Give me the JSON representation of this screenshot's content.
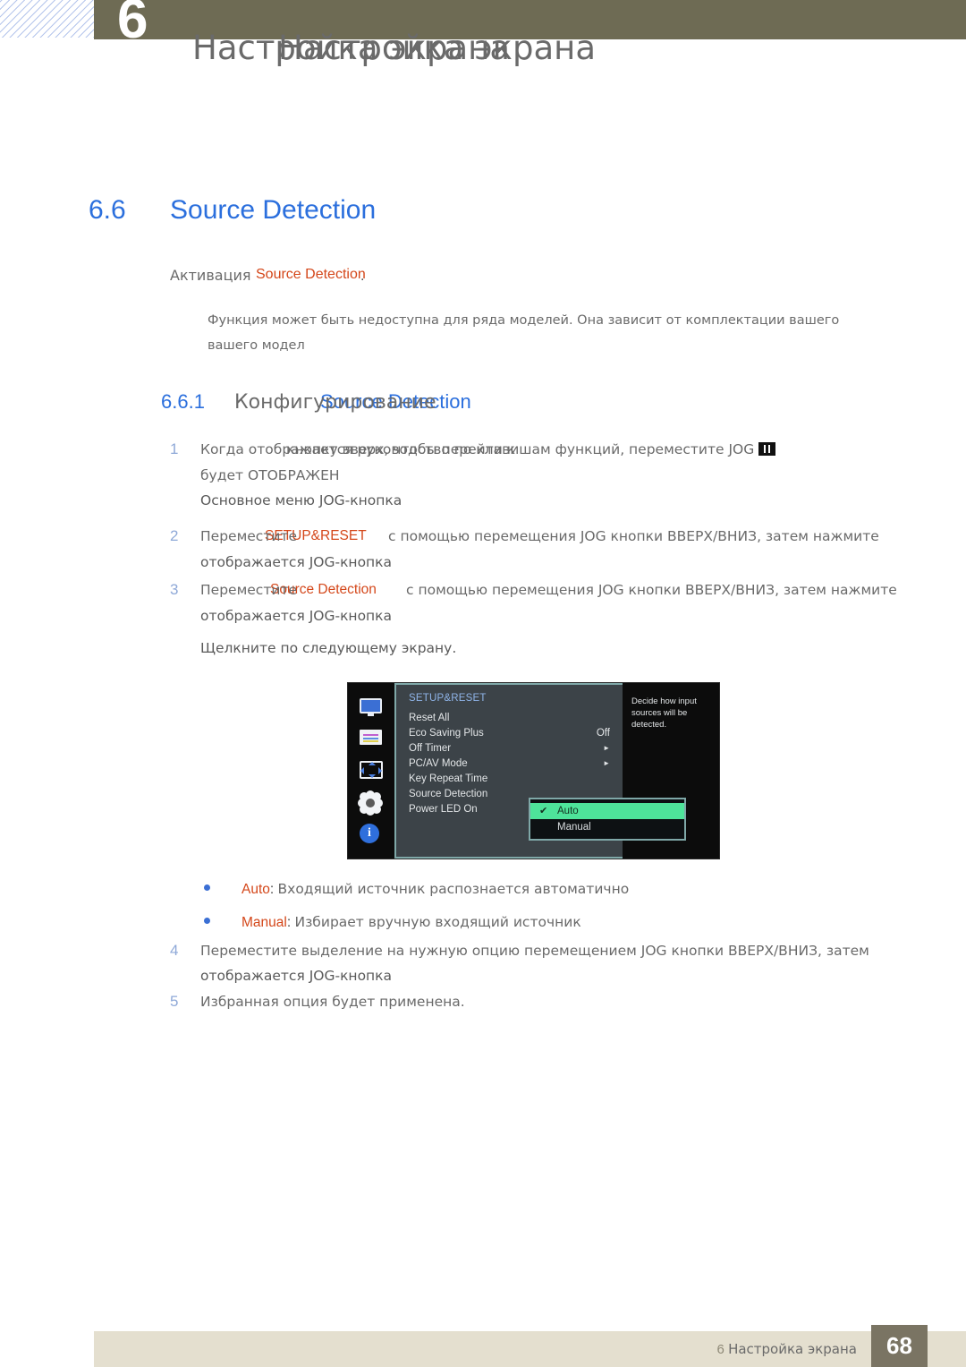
{
  "header": {
    "chapter_number": "6",
    "chapter_title_primary": "Настройка экрана",
    "chapter_title_overlay": "Настройка экрана"
  },
  "section": {
    "number": "6.6",
    "title": "Source Detection"
  },
  "lead_paragraph": {
    "prefix_cyrillic": "Активация",
    "highlight": "Source Detection",
    "suffix": "."
  },
  "note": {
    "line1": "Функция может быть недоступна для ряда моделей. Она зависит от комплектации вашего",
    "line2": "вашего модел"
  },
  "subsection": {
    "number": "6.6.1",
    "title_cyrillic": "Конфигурирование",
    "title_en": "Source Detection"
  },
  "steps": [
    {
      "number": "1",
      "line1_a": "Когда отображается руководство по клавишам функций, переместите JOG",
      "line1_b": "кнопку вверх, чтобы перейти к",
      "icon": "jog-button-icon",
      "line2": "будет ОТОБРАЖЕН",
      "sub": "Основное меню JOG-кнопка"
    },
    {
      "number": "2",
      "line1_a": "Переместите",
      "highlight": "SETUP&RESET",
      "line1_b": "с помощью перемещения JOG кнопки ВВЕРХ/ВНИЗ, затем нажмите",
      "sub": "отображается JOG-кнопка"
    },
    {
      "number": "3",
      "line1_a": "Переместите",
      "highlight": "Source Detection",
      "line1_b": "с помощью перемещения JOG кнопки ВВЕРХ/ВНИЗ, затем нажмите",
      "sub": "отображается JOG-кнопка",
      "sub2": "Щелкните по следующему экрану."
    },
    {
      "number": "4",
      "line1_a": "Переместите выделение на нужную опцию перемещением JOG кнопки ВВЕРХ/ВНИЗ, затем",
      "sub": "отображается JOG-кнопка"
    },
    {
      "number": "5",
      "line1_a": "Избранная опция будет применена."
    }
  ],
  "osd": {
    "heading": "SETUP&RESET",
    "rows": [
      {
        "label": "Reset All",
        "value": "",
        "arrow": false
      },
      {
        "label": "Eco Saving Plus",
        "value": "Off",
        "arrow": false
      },
      {
        "label": "Off Timer",
        "value": "",
        "arrow": true
      },
      {
        "label": "PC/AV Mode",
        "value": "",
        "arrow": true
      },
      {
        "label": "Key Repeat Time",
        "value": "",
        "arrow": false
      },
      {
        "label": "Source Detection",
        "value": "",
        "arrow": false
      },
      {
        "label": "Power LED On",
        "value": "",
        "arrow": false
      }
    ],
    "description": "Decide how input sources will be detected.",
    "dropdown": {
      "options": [
        {
          "label": "Auto",
          "selected": true,
          "check": "✔"
        },
        {
          "label": "Manual",
          "selected": false,
          "check": ""
        }
      ]
    },
    "rail_icons": [
      "monitor-icon",
      "picture-settings-icon",
      "position-arrows-icon",
      "gear-icon",
      "info-icon"
    ],
    "colors": {
      "highlight_green": "#4ee49a",
      "frame_teal": "#7fa8a8",
      "panel_bg": "#3c4348",
      "heading_blue": "#8fb4e8"
    }
  },
  "bullets": [
    {
      "label": "Auto",
      "separator": ":",
      "text": "Входящий источник распознается автоматично"
    },
    {
      "label": "Manual",
      "separator": ":",
      "text": "Избирает вручную входящий источник"
    }
  ],
  "footer": {
    "chapter": "6",
    "title": "Настройка экрана",
    "page_number": "68"
  },
  "colors": {
    "accent_blue": "#2b6fdd",
    "accent_orange": "#d4471a",
    "band_olive": "#6e6b54",
    "footer_band": "#e4dfcf",
    "page_box": "#7a7463"
  }
}
